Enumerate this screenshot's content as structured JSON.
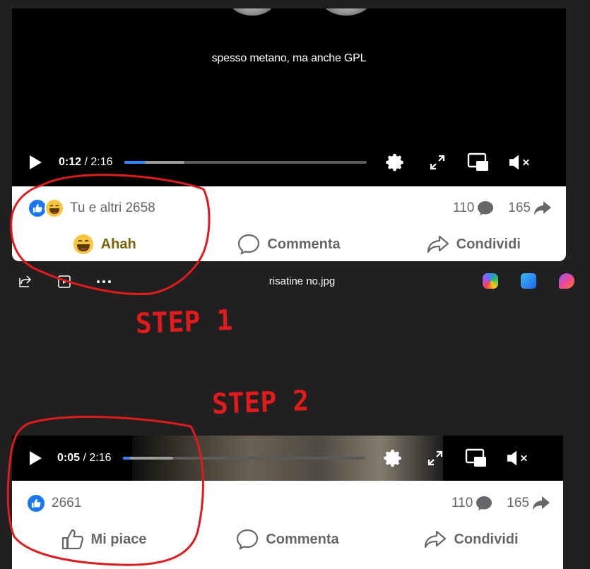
{
  "top_post": {
    "subtitle": "spesso metano, ma anche GPL",
    "video": {
      "current_time": "0:12",
      "duration": "/ 2:16",
      "played_fraction": 0.09,
      "buffered_fraction": 0.25
    },
    "reaction_summary": "Tu e altri 2658",
    "comments_count": "110",
    "shares_count": "165",
    "actions": {
      "react": "Ahah",
      "comment": "Commenta",
      "share": "Condividi"
    }
  },
  "viewer": {
    "file_name": "risatine no.jpg",
    "icons": [
      "share-icon",
      "present-icon",
      "more-icon",
      "copilot-icon",
      "photos-icon",
      "clipchamp-icon"
    ]
  },
  "annotations": {
    "step1": "STEP 1",
    "step2": "STEP 2",
    "color": "#e11b1b"
  },
  "bottom_post": {
    "video": {
      "current_time": "0:05",
      "duration": "/ 2:16",
      "played_fraction": 0.03,
      "buffered_fraction": 0.21
    },
    "reaction_count": "2661",
    "comments_count": "110",
    "shares_count": "165",
    "actions": {
      "like": "Mi piace",
      "comment": "Commenta",
      "share": "Condividi"
    }
  },
  "colors": {
    "facebook_blue": "#2d88ff",
    "like_blue": "#1877f2",
    "haha_yellow": "#f7c53e",
    "text_gray": "#65676b"
  }
}
